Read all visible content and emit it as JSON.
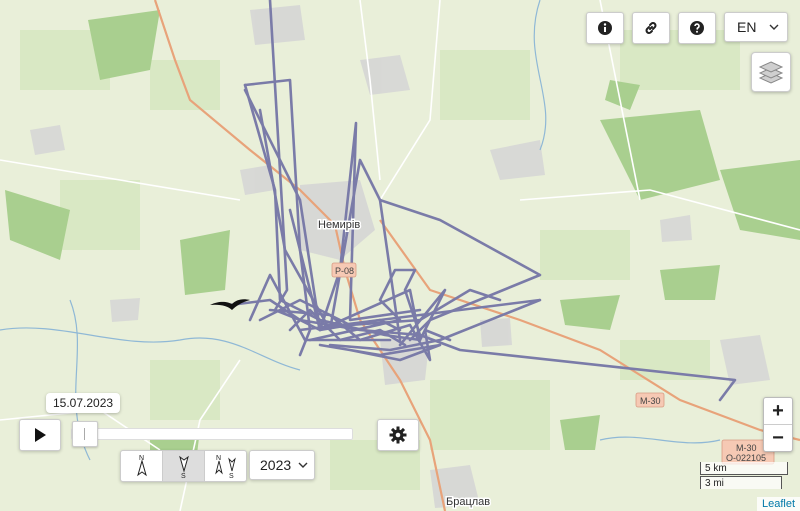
{
  "map": {
    "labels": {
      "town": "Немирів",
      "road_p08": "Р-08",
      "road_m30": "М-30",
      "road_m30_b": "М-30",
      "road_o022105": "О-022105",
      "town_south": "Брацлав"
    }
  },
  "controls": {
    "info_icon": "info-icon",
    "link_icon": "link-icon",
    "help_icon": "help-icon",
    "language": "EN",
    "layers_icon": "layers-icon",
    "zoom_in": "+",
    "zoom_out": "−"
  },
  "timeline": {
    "date": "15.07.2023",
    "play_icon": "play-icon",
    "settings_icon": "gear-icon",
    "year": "2023",
    "progress": 0.0
  },
  "compass": {
    "modes": [
      {
        "top": "N",
        "bottom": ""
      },
      {
        "top": "",
        "bottom": "S"
      },
      {
        "top": "N",
        "bottom": "S"
      }
    ],
    "active_index": 1
  },
  "scale": {
    "metric": "5 km",
    "imperial": "3 mi"
  },
  "attribution": "Leaflet",
  "colors": {
    "track": "#7a7ba8",
    "road": "#e8a37a",
    "forest": "#b2d29a"
  }
}
